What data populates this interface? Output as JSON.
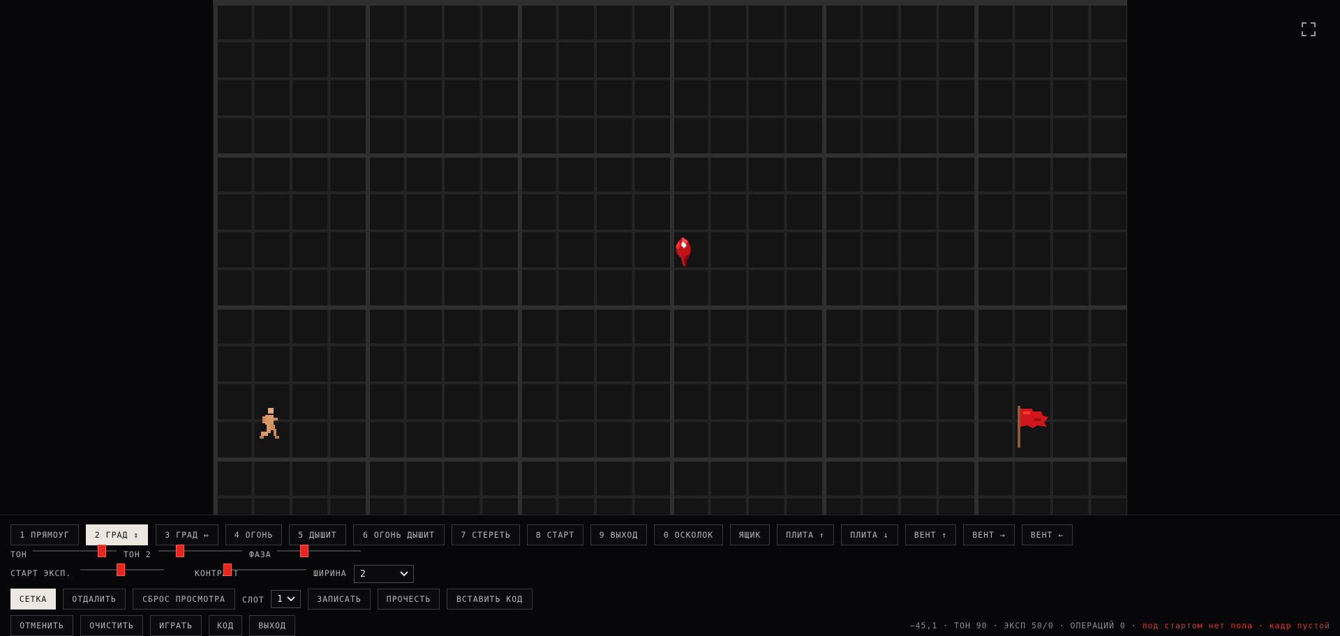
{
  "toolbar_tools": [
    {
      "label": "1 ПРЯМОУГ",
      "active": false
    },
    {
      "label": "2 ГРАД ⇕",
      "active": true
    },
    {
      "label": "3 ГРАД ⇔",
      "active": false
    },
    {
      "label": "4 ОГОНЬ",
      "active": false
    },
    {
      "label": "5 ДЫШИТ",
      "active": false
    },
    {
      "label": "6 ОГОНЬ ДЫШИТ",
      "active": false
    },
    {
      "label": "7 СТЕРЕТЬ",
      "active": false
    },
    {
      "label": "8 СТАРТ",
      "active": false
    },
    {
      "label": "9 ВЫХОД",
      "active": false
    },
    {
      "label": "0 ОСКОЛОК",
      "active": false
    },
    {
      "label": "ЯЩИК",
      "active": false
    },
    {
      "label": "ПЛИТА ↑",
      "active": false
    },
    {
      "label": "ПЛИТА ↓",
      "active": false
    },
    {
      "label": "ВЕНТ ↑",
      "active": false
    },
    {
      "label": "ВЕНТ →",
      "active": false
    },
    {
      "label": "ВЕНТ ←",
      "active": false
    }
  ],
  "sliders_row1": [
    {
      "label": "ТОН",
      "value": 0.86
    },
    {
      "label": "ТОН 2",
      "value": 0.23
    },
    {
      "label": "ФАЗА",
      "value": 0.31
    }
  ],
  "sliders_row2": [
    {
      "label": "СТАРТ ЭКСП.",
      "value": 0.48
    },
    {
      "label": "КОНТРАСТ",
      "value": 0.01
    }
  ],
  "width_select": {
    "label": "ШИРИНА",
    "value": "2"
  },
  "row3": {
    "grid": "СЕТКА",
    "zoom_out": "ОТДАЛИТЬ",
    "reset_view": "СБРОС ПРОСМОТРА",
    "slot_label": "СЛОТ",
    "slot_value": "1",
    "write": "ЗАПИСАТЬ",
    "read": "ПРОЧЕСТЬ",
    "paste_code": "ВСТАВИТЬ КОД"
  },
  "row4": {
    "undo": "ОТМЕНИТЬ",
    "clear": "ОЧИСТИТЬ",
    "play": "ИГРАТЬ",
    "code": "КОД",
    "exit": "ВЫХОД"
  },
  "status": {
    "coords": "−45,1",
    "tone": "ТОН 90",
    "exp": "ЭКСП 50/0",
    "ops": "ОПЕРАЦИЙ 0",
    "warn1": "под стартом нет пола",
    "warn2": "кадр пустой",
    "sep": " · "
  },
  "colors": {
    "accent": "#e8261e",
    "active_button_bg": "#ece8df",
    "grid_major": "#2f2f2f",
    "grid_minor": "#242424",
    "canvas_bg": "#141414"
  },
  "icons": {
    "fullscreen": "fullscreen-icon",
    "player": "player-sprite",
    "shard": "red-shard-sprite",
    "exit": "red-flag-sprite"
  }
}
